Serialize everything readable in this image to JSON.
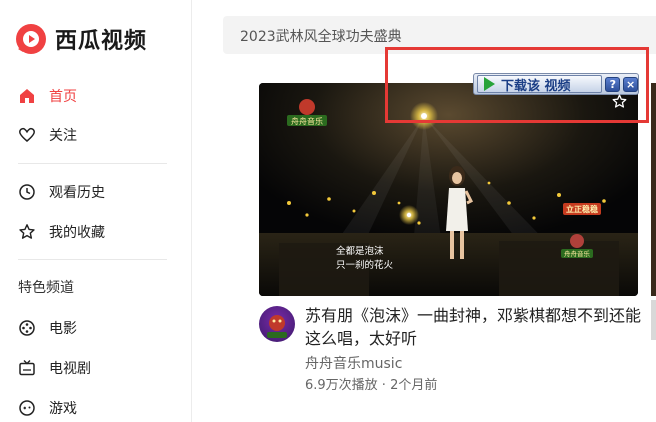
{
  "app": {
    "logo_text": "西瓜视频"
  },
  "sidebar": {
    "items": [
      {
        "label": "首页"
      },
      {
        "label": "关注"
      },
      {
        "label": "观看历史"
      },
      {
        "label": "我的收藏"
      }
    ],
    "section_title": "特色频道",
    "channels": [
      {
        "label": "电影"
      },
      {
        "label": "电视剧"
      },
      {
        "label": "游戏"
      }
    ]
  },
  "search": {
    "text": "2023武林风全球功夫盛典"
  },
  "download_bar": {
    "label": "下载该 视频",
    "help": "?",
    "close": "×"
  },
  "video": {
    "title": "苏有朋《泡沫》一曲封神，邓紫棋都想不到还能这么唱，太好听",
    "author": "舟舟音乐music",
    "meta": "6.9万次播放 · 2个月前",
    "overlay": {
      "channel_badge": "舟舟音乐",
      "lyric_line1": "全都是泡沫",
      "lyric_line2": "只一刹的花火",
      "stage_sign": "立正稳稳",
      "small_badge": "舟舟音乐"
    }
  },
  "colors": {
    "accent": "#f04142",
    "highlight_box": "#e53935"
  }
}
